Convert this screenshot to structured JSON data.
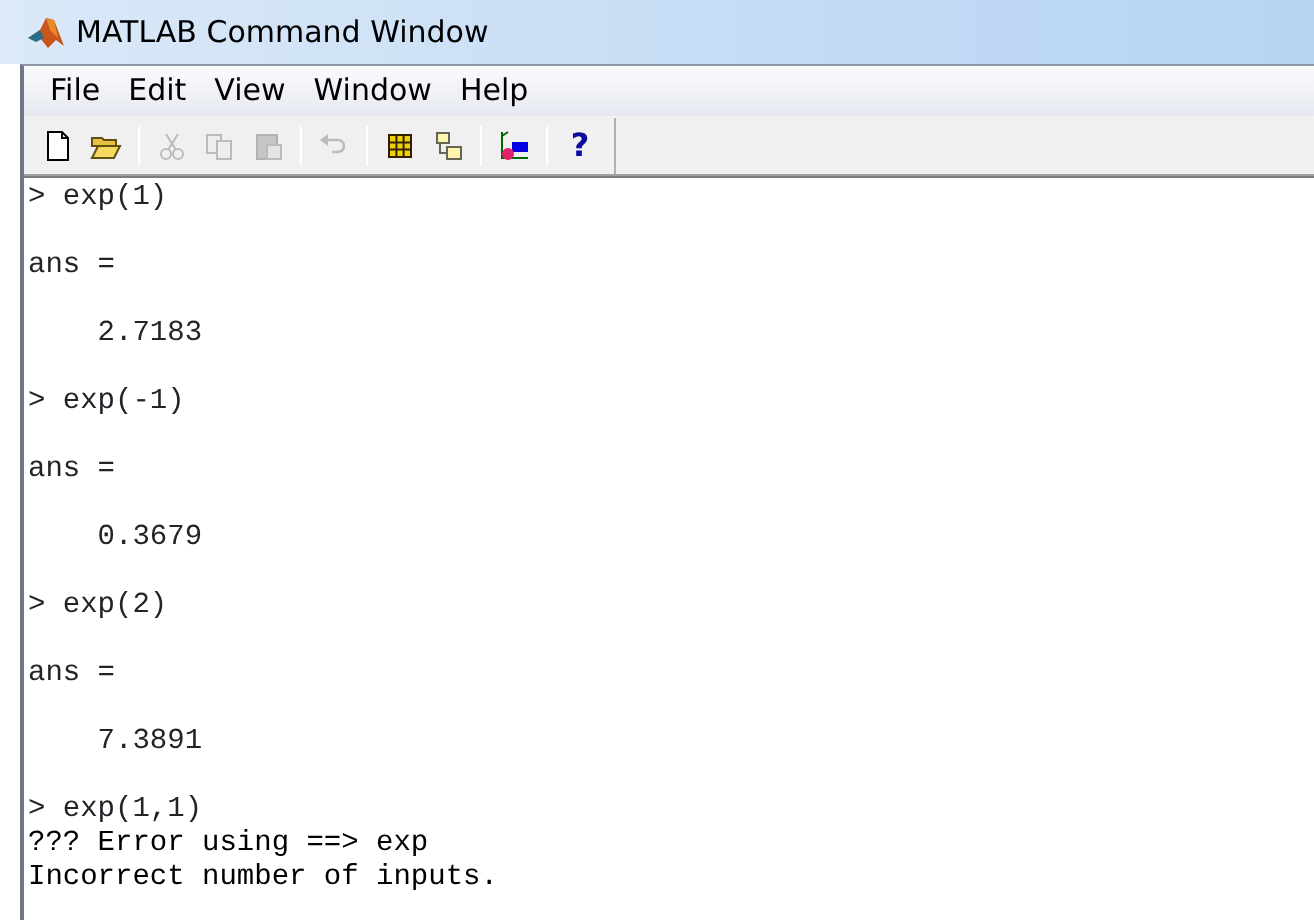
{
  "window": {
    "title": "MATLAB Command Window"
  },
  "menu": [
    {
      "label": "File"
    },
    {
      "label": "Edit"
    },
    {
      "label": "View"
    },
    {
      "label": "Window"
    },
    {
      "label": "Help"
    }
  ],
  "toolbar": [
    {
      "kind": "new",
      "disabled": false
    },
    {
      "kind": "open",
      "disabled": false
    },
    {
      "kind": "separator"
    },
    {
      "kind": "cut",
      "disabled": true
    },
    {
      "kind": "copy",
      "disabled": true
    },
    {
      "kind": "paste",
      "disabled": true
    },
    {
      "kind": "separator"
    },
    {
      "kind": "undo",
      "disabled": true
    },
    {
      "kind": "separator"
    },
    {
      "kind": "workspace",
      "disabled": false
    },
    {
      "kind": "path",
      "disabled": false
    },
    {
      "kind": "separator"
    },
    {
      "kind": "simulink",
      "disabled": false
    },
    {
      "kind": "separator"
    },
    {
      "kind": "help",
      "label": "?",
      "disabled": false
    }
  ],
  "lines": [
    {
      "kind": "input",
      "text": "> exp(1)"
    },
    {
      "kind": "blank"
    },
    {
      "kind": "output",
      "text": "ans ="
    },
    {
      "kind": "blank"
    },
    {
      "kind": "output",
      "text": "    2.7183"
    },
    {
      "kind": "blank"
    },
    {
      "kind": "input",
      "text": "> exp(-1)"
    },
    {
      "kind": "blank"
    },
    {
      "kind": "output",
      "text": "ans ="
    },
    {
      "kind": "blank"
    },
    {
      "kind": "output",
      "text": "    0.3679"
    },
    {
      "kind": "blank"
    },
    {
      "kind": "input",
      "text": "> exp(2)"
    },
    {
      "kind": "blank"
    },
    {
      "kind": "output",
      "text": "ans ="
    },
    {
      "kind": "blank"
    },
    {
      "kind": "output",
      "text": "    7.3891"
    },
    {
      "kind": "blank"
    },
    {
      "kind": "input",
      "text": "> exp(1,1)"
    },
    {
      "kind": "error",
      "text": "??? Error using ==> exp"
    },
    {
      "kind": "error",
      "text": "Incorrect number of inputs."
    }
  ]
}
